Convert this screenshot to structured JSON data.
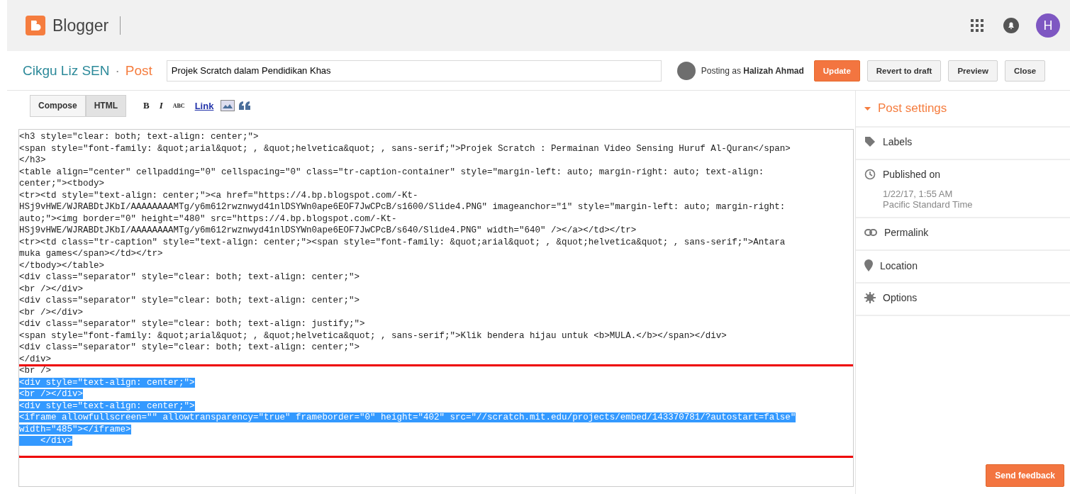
{
  "header": {
    "brand": "Blogger",
    "avatar_letter": "H"
  },
  "post_bar": {
    "blog_name": "Cikgu Liz SEN",
    "separator": "·",
    "section": "Post",
    "title_value": "Projek Scratch dalam Pendidikan Khas",
    "posting_as": "Posting as **Halizah Ahmad**",
    "buttons": [
      {
        "label": "Update",
        "kind": "primary"
      },
      {
        "label": "Revert to draft",
        "kind": "plain"
      },
      {
        "label": "Preview",
        "kind": "plain"
      },
      {
        "label": "Close",
        "kind": "plain"
      }
    ]
  },
  "mode_tabs": [
    {
      "label": "Compose",
      "selected": false
    },
    {
      "label": "HTML",
      "selected": true
    }
  ],
  "toolbar": [
    {
      "kind": "bold",
      "label": "B"
    },
    {
      "kind": "italic",
      "label": "I"
    },
    {
      "kind": "spell",
      "label": "ABC"
    },
    {
      "kind": "link",
      "label": "Link"
    },
    {
      "kind": "image"
    },
    {
      "kind": "quote"
    }
  ],
  "code_lines": [
    {
      "text": "<h3 style=\"clear: both; text-align: center;\">",
      "selected": false
    },
    {
      "text": "<span style=\"font-family: &quot;arial&quot; , &quot;helvetica&quot; , sans-serif;\">Projek Scratch : Permainan Video Sensing Huruf Al-Quran</span>",
      "selected": false
    },
    {
      "text": "</h3>",
      "selected": false
    },
    {
      "text": "<table align=\"center\" cellpadding=\"0\" cellspacing=\"0\" class=\"tr-caption-container\" style=\"margin-left: auto; margin-right: auto; text-align:",
      "selected": false
    },
    {
      "text": "center;\"><tbody>",
      "selected": false
    },
    {
      "text": "<tr><td style=\"text-align: center;\"><a href=\"https://4.bp.blogspot.com/-Kt-",
      "selected": false
    },
    {
      "text": "HSj9vHWE/WJRABDtJKbI/AAAAAAAAMTg/y6m612rwznwyd41nlDSYWn0ape6EOF7JwCPcB/s1600/Slide4.PNG\" imageanchor=\"1\" style=\"margin-left: auto; margin-right:",
      "selected": false
    },
    {
      "text": "auto;\"><img border=\"0\" height=\"480\" src=\"https://4.bp.blogspot.com/-Kt-",
      "selected": false
    },
    {
      "text": "HSj9vHWE/WJRABDtJKbI/AAAAAAAAMTg/y6m612rwznwyd41nlDSYWn0ape6EOF7JwCPcB/s640/Slide4.PNG\" width=\"640\" /></a></td></tr>",
      "selected": false
    },
    {
      "text": "<tr><td class=\"tr-caption\" style=\"text-align: center;\"><span style=\"font-family: &quot;arial&quot; , &quot;helvetica&quot; , sans-serif;\">Antara",
      "selected": false
    },
    {
      "text": "muka games</span></td></tr>",
      "selected": false
    },
    {
      "text": "</tbody></table>",
      "selected": false
    },
    {
      "text": "<div class=\"separator\" style=\"clear: both; text-align: center;\">",
      "selected": false
    },
    {
      "text": "<br /></div>",
      "selected": false
    },
    {
      "text": "<div class=\"separator\" style=\"clear: both; text-align: center;\">",
      "selected": false
    },
    {
      "text": "<br /></div>",
      "selected": false
    },
    {
      "text": "<div class=\"separator\" style=\"clear: both; text-align: justify;\">",
      "selected": false
    },
    {
      "text": "<span style=\"font-family: &quot;arial&quot; , &quot;helvetica&quot; , sans-serif;\">Klik bendera hijau untuk <b>MULA.</b></span></div>",
      "selected": false
    },
    {
      "text": "<div class=\"separator\" style=\"clear: both; text-align: center;\">",
      "selected": false
    },
    {
      "text": "</div>",
      "selected": false
    },
    {
      "text": "<br />",
      "selected": false
    },
    {
      "text": "<div style=\"text-align: center;\">",
      "selected": true
    },
    {
      "text": "<br /></div>",
      "selected": true
    },
    {
      "text": "<div style=\"text-align: center;\">",
      "selected": true
    },
    {
      "text": "<iframe allowfullscreen=\"\" allowtransparency=\"true\" frameborder=\"0\" height=\"402\" src=\"//scratch.mit.edu/projects/embed/143370781/?autostart=false\"",
      "selected": true
    },
    {
      "text": "width=\"485\"></iframe>",
      "selected": true
    },
    {
      "text": "    </div>",
      "selected": true
    }
  ],
  "sidebar": {
    "title": "Post settings",
    "items": [
      {
        "label": "Labels"
      },
      {
        "label": "Published on",
        "details": [
          "1/22/17, 1:55 AM",
          "Pacific Standard Time"
        ]
      },
      {
        "label": "Permalink"
      },
      {
        "label": "Location"
      },
      {
        "label": "Options"
      }
    ]
  },
  "feedback_button": "Send feedback"
}
